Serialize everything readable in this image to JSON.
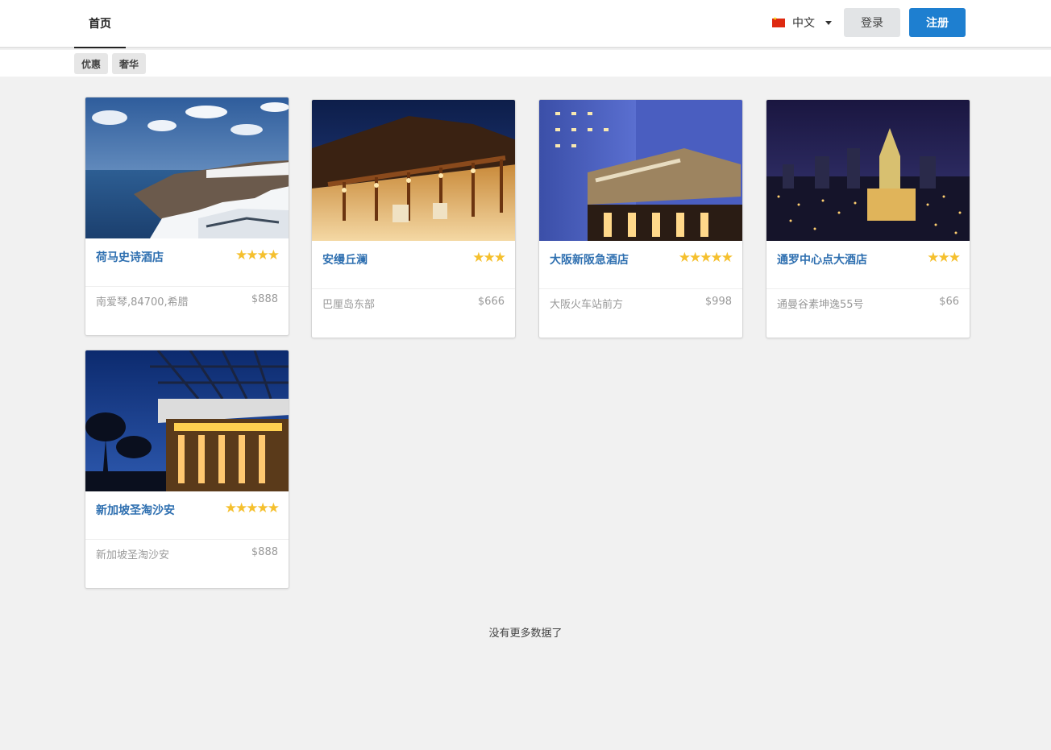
{
  "nav": {
    "home_label": "首页"
  },
  "language": {
    "label": "中文"
  },
  "auth": {
    "login_label": "登录",
    "register_label": "注册"
  },
  "tags": [
    {
      "label": "优惠"
    },
    {
      "label": "奢华"
    }
  ],
  "hotels": [
    {
      "name": "荷马史诗酒店",
      "stars": 4,
      "address": "南爱琴,84700,希腊",
      "price": "$888",
      "image": "santorini-cliff-photo"
    },
    {
      "name": "安缦丘澜",
      "stars": 3,
      "address": "巴厘岛东部",
      "price": "$666",
      "image": "bali-pavilion-night-photo"
    },
    {
      "name": "大阪新阪急酒店",
      "stars": 5,
      "address": "大阪火车站前方",
      "price": "$998",
      "image": "osaka-hotel-facade-photo"
    },
    {
      "name": "通罗中心点大酒店",
      "stars": 3,
      "address": "通曼谷素坤逸55号",
      "price": "$66",
      "image": "bangkok-skyline-night-photo"
    },
    {
      "name": "新加坡圣淘沙安",
      "stars": 5,
      "address": "新加坡圣淘沙安",
      "price": "$888",
      "image": "sentosa-resort-entrance-photo"
    }
  ],
  "footer": {
    "no_more_text": "没有更多数据了"
  },
  "colors": {
    "accent": "#1e7fd0",
    "hotel_name": "#2e6fb0",
    "star": "#f5c02e",
    "background": "#f1f1f1"
  }
}
